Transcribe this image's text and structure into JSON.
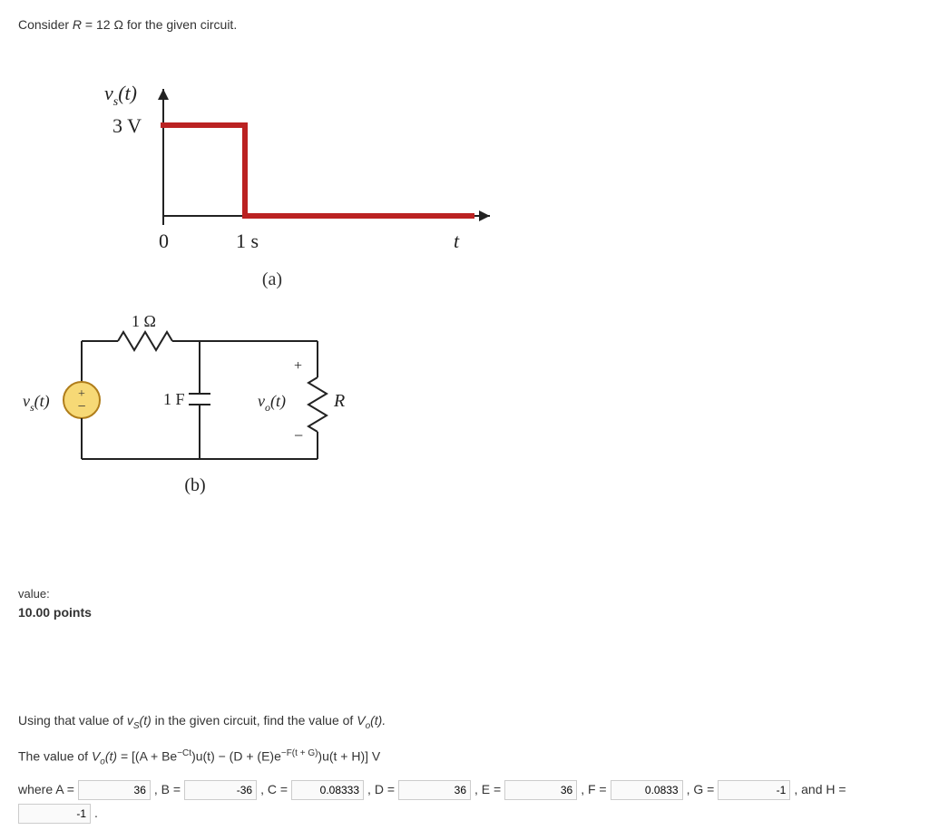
{
  "prompt": {
    "prefix": "Consider ",
    "R": "R",
    "equals": " = 12 Ω for the given circuit."
  },
  "graph": {
    "ylabel_vs": "v",
    "ylabel_sub": "s",
    "ylabel_arg": "(t)",
    "yval": "3 V",
    "x0": "0",
    "x1": "1 s",
    "xlabel": "t",
    "caption": "(a)"
  },
  "circuit": {
    "r_label": "1 Ω",
    "c_label": "1 F",
    "src_label_v": "v",
    "src_label_sub": "s",
    "src_label_arg": "(t)",
    "vo_v": "v",
    "vo_sub": "o",
    "vo_arg": "(t)",
    "R_label": "R",
    "plus": "+",
    "minus": "−",
    "caption": "(b)"
  },
  "value": {
    "label": "value:",
    "points": "10.00 points"
  },
  "question": "Using that value of ",
  "question_vs_v": "v",
  "question_vs_sub": "S",
  "question_vs_arg": "(t)",
  "question_rest": " in the given circuit, find the value of ",
  "question_vo_v": "V",
  "question_vo_sub": "o",
  "question_vo_arg": "(t).",
  "formula": {
    "lead": "The value of ",
    "Vo_v": "V",
    "Vo_sub": "o",
    "Vo_arg": "(t)",
    "body": " = [(A + Be",
    "exp1": "−Ct",
    "body2": ")u(t) − (D + (E)e",
    "exp2": "−F(t + G)",
    "body3": ")u(t + H)] V"
  },
  "answers": {
    "where": "where A = ",
    "A": "36",
    "B_lbl": ", B = ",
    "B": "-36",
    "C_lbl": ", C = ",
    "C": "0.08333",
    "D_lbl": ", D = ",
    "D": "36",
    "E_lbl": ", E = ",
    "E": "36",
    "F_lbl": ", F = ",
    "F": "0.0833",
    "G_lbl": ", G = ",
    "G": "-1",
    "H_lbl": ", and H = ",
    "H": "-1",
    "end": "."
  }
}
